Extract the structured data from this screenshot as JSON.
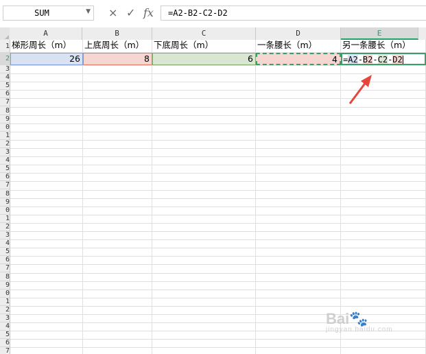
{
  "formula_bar": {
    "name_box": "SUM",
    "cancel_icon": "×",
    "confirm_icon": "✓",
    "fx_label": "fx",
    "formula": "=A2-B2-C2-D2"
  },
  "columns": [
    "A",
    "B",
    "C",
    "D",
    "E"
  ],
  "selected_column": "E",
  "row_numbers": [
    "1",
    "2",
    "3",
    "4",
    "5",
    "6",
    "7",
    "8",
    "9",
    "0",
    "1",
    "2",
    "3",
    "4",
    "5",
    "6",
    "7",
    "8",
    "9",
    "0",
    "1",
    "2",
    "3",
    "4",
    "5",
    "6",
    "7",
    "8",
    "9",
    "0",
    "1",
    "2",
    "3",
    "4",
    "5",
    "6",
    "7",
    "8"
  ],
  "header_row": {
    "A": "梯形周长（m）",
    "B": "上底周长（m）",
    "C": "下底周长（m）",
    "D": "一条腰长（m）",
    "E": "另一条腰长（m）"
  },
  "data_row": {
    "A": "26",
    "B": "8",
    "C": "6",
    "D": "4"
  },
  "editing_formula_tokens": [
    "=",
    "A2",
    "-",
    "B2",
    "-",
    "C2",
    "-",
    "D2"
  ],
  "colors": {
    "ref_a": "#d8e2f3",
    "ref_b": "#f6d6d0",
    "ref_c": "#d9e6d2",
    "ref_d": "#f6d6d0",
    "active_green": "#21a366",
    "arrow_red": "#e8453c"
  },
  "watermark": {
    "logo": "Bai",
    "tagline": "jingyan.baidu.com"
  }
}
